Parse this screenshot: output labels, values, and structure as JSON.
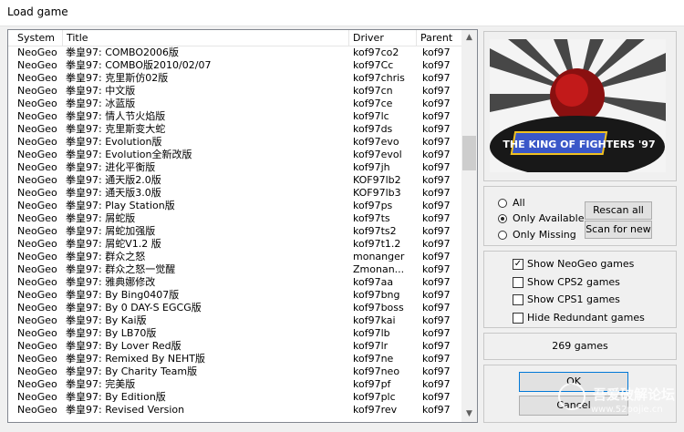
{
  "window": {
    "title": "Load game"
  },
  "list": {
    "columns": {
      "system": "System",
      "title": "Title",
      "driver": "Driver",
      "parent": "Parent"
    },
    "rows": [
      {
        "system": "NeoGeo",
        "title": "拳皇97: COMBO2006版",
        "driver": "kof97co2",
        "parent": "kof97"
      },
      {
        "system": "NeoGeo",
        "title": "拳皇97: COMBO版2010/02/07",
        "driver": "kof97Cc",
        "parent": "kof97"
      },
      {
        "system": "NeoGeo",
        "title": "拳皇97: 克里斯仿02版",
        "driver": "kof97chris",
        "parent": "kof97"
      },
      {
        "system": "NeoGeo",
        "title": "拳皇97: 中文版",
        "driver": "kof97cn",
        "parent": "kof97"
      },
      {
        "system": "NeoGeo",
        "title": "拳皇97: 冰蓝版",
        "driver": "kof97ce",
        "parent": "kof97"
      },
      {
        "system": "NeoGeo",
        "title": "拳皇97: 情人节火焰版",
        "driver": "kof97lc",
        "parent": "kof97"
      },
      {
        "system": "NeoGeo",
        "title": "拳皇97: 克里斯变大蛇",
        "driver": "kof97ds",
        "parent": "kof97"
      },
      {
        "system": "NeoGeo",
        "title": "拳皇97: Evolution版",
        "driver": "kof97evo",
        "parent": "kof97"
      },
      {
        "system": "NeoGeo",
        "title": "拳皇97: Evolution全新改版",
        "driver": "kof97evol",
        "parent": "kof97"
      },
      {
        "system": "NeoGeo",
        "title": "拳皇97: 进化平衡版",
        "driver": "kof97jh",
        "parent": "kof97"
      },
      {
        "system": "NeoGeo",
        "title": "拳皇97: 通天版2.0版",
        "driver": "KOF97lb2",
        "parent": "kof97"
      },
      {
        "system": "NeoGeo",
        "title": "拳皇97: 通天版3.0版",
        "driver": "KOF97lb3",
        "parent": "kof97"
      },
      {
        "system": "NeoGeo",
        "title": "拳皇97: Play Station版",
        "driver": "kof97ps",
        "parent": "kof97"
      },
      {
        "system": "NeoGeo",
        "title": "拳皇97: 屑蛇版",
        "driver": "kof97ts",
        "parent": "kof97"
      },
      {
        "system": "NeoGeo",
        "title": "拳皇97: 屑蛇加强版",
        "driver": "kof97ts2",
        "parent": "kof97"
      },
      {
        "system": "NeoGeo",
        "title": "拳皇97: 屑蛇V1.2 版",
        "driver": "kof97t1.2",
        "parent": "kof97"
      },
      {
        "system": "NeoGeo",
        "title": "拳皇97: 群众之怒",
        "driver": "monanger",
        "parent": "kof97"
      },
      {
        "system": "NeoGeo",
        "title": "拳皇97: 群众之怒一觉醒",
        "driver": "Zmonan...",
        "parent": "kof97"
      },
      {
        "system": "NeoGeo",
        "title": "拳皇97: 雅典娜修改",
        "driver": "kof97aa",
        "parent": "kof97"
      },
      {
        "system": "NeoGeo",
        "title": "拳皇97: By Bing0407版",
        "driver": "kof97bng",
        "parent": "kof97"
      },
      {
        "system": "NeoGeo",
        "title": "拳皇97: By 0 DAY-S EGCG版",
        "driver": "kof97boss",
        "parent": "kof97"
      },
      {
        "system": "NeoGeo",
        "title": "拳皇97: By Kai版",
        "driver": "kof97kai",
        "parent": "kof97"
      },
      {
        "system": "NeoGeo",
        "title": "拳皇97: By LB70版",
        "driver": "kof97lb",
        "parent": "kof97"
      },
      {
        "system": "NeoGeo",
        "title": "拳皇97: By Lover Red版",
        "driver": "kof97lr",
        "parent": "kof97"
      },
      {
        "system": "NeoGeo",
        "title": "拳皇97: Remixed By NEHT版",
        "driver": "kof97ne",
        "parent": "kof97"
      },
      {
        "system": "NeoGeo",
        "title": "拳皇97: By Charity Team版",
        "driver": "kof97neo",
        "parent": "kof97"
      },
      {
        "system": "NeoGeo",
        "title": "拳皇97: 完美版",
        "driver": "kof97pf",
        "parent": "kof97"
      },
      {
        "system": "NeoGeo",
        "title": "拳皇97: By Edition版",
        "driver": "kof97plc",
        "parent": "kof97"
      },
      {
        "system": "NeoGeo",
        "title": "拳皇97: Revised Version",
        "driver": "kof97rev",
        "parent": "kof97"
      }
    ]
  },
  "preview": {
    "logo_text": "THE KING OF FIGHTERS '97"
  },
  "filter": {
    "options": [
      "All",
      "Only Available",
      "Only Missing"
    ],
    "selected": "Only Available",
    "rescan_all": "Rescan all",
    "scan_for_new": "Scan for new"
  },
  "show": [
    {
      "label": "Show NeoGeo games",
      "checked": true
    },
    {
      "label": "Show CPS2 games",
      "checked": false
    },
    {
      "label": "Show CPS1 games",
      "checked": false
    },
    {
      "label": "Hide Redundant games",
      "checked": false
    }
  ],
  "count": "269 games",
  "actions": {
    "ok": "OK",
    "cancel": "Cancel"
  },
  "watermark": {
    "line1": "吾爱破解论坛",
    "line2": "www.52pojie.cn"
  }
}
